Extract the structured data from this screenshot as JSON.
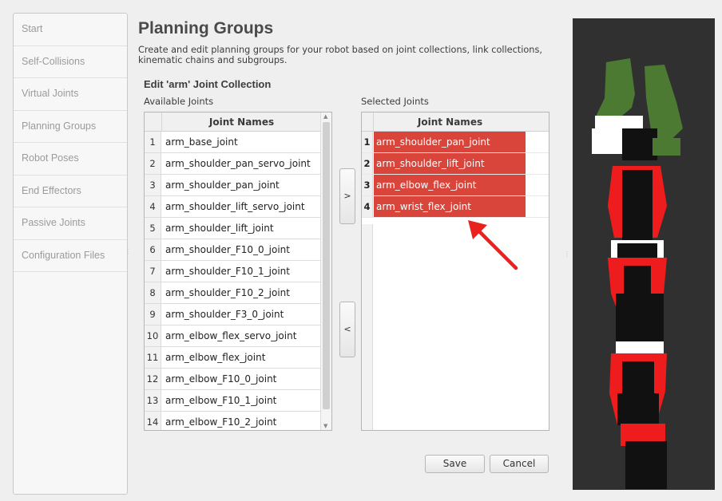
{
  "sidebar": {
    "items": [
      {
        "label": "Start"
      },
      {
        "label": "Self-Collisions"
      },
      {
        "label": "Virtual Joints"
      },
      {
        "label": "Planning Groups"
      },
      {
        "label": "Robot Poses"
      },
      {
        "label": "End Effectors"
      },
      {
        "label": "Passive Joints"
      },
      {
        "label": "Configuration Files"
      }
    ]
  },
  "main": {
    "title": "Planning Groups",
    "description": "Create and edit planning groups for your robot based on joint collections, link collections, kinematic chains and subgroups.",
    "subtitle": "Edit 'arm' Joint Collection",
    "available_label": "Available Joints",
    "selected_label": "Selected Joints",
    "column_header": "Joint Names",
    "available_joints": [
      {
        "num": "1",
        "name": "arm_base_joint"
      },
      {
        "num": "2",
        "name": "arm_shoulder_pan_servo_joint"
      },
      {
        "num": "3",
        "name": "arm_shoulder_pan_joint"
      },
      {
        "num": "4",
        "name": "arm_shoulder_lift_servo_joint"
      },
      {
        "num": "5",
        "name": "arm_shoulder_lift_joint"
      },
      {
        "num": "6",
        "name": "arm_shoulder_F10_0_joint"
      },
      {
        "num": "7",
        "name": "arm_shoulder_F10_1_joint"
      },
      {
        "num": "8",
        "name": "arm_shoulder_F10_2_joint"
      },
      {
        "num": "9",
        "name": "arm_shoulder_F3_0_joint"
      },
      {
        "num": "10",
        "name": "arm_elbow_flex_servo_joint"
      },
      {
        "num": "11",
        "name": "arm_elbow_flex_joint"
      },
      {
        "num": "12",
        "name": "arm_elbow_F10_0_joint"
      },
      {
        "num": "13",
        "name": "arm_elbow_F10_1_joint"
      },
      {
        "num": "14",
        "name": "arm_elbow_F10_2_joint"
      }
    ],
    "selected_joints": [
      {
        "num": "1",
        "name": "arm_shoulder_pan_joint"
      },
      {
        "num": "2",
        "name": "arm_shoulder_lift_joint"
      },
      {
        "num": "3",
        "name": "arm_elbow_flex_joint"
      },
      {
        "num": "4",
        "name": "arm_wrist_flex_joint"
      }
    ],
    "add_label": ">",
    "remove_label": "<",
    "save_label": "Save",
    "cancel_label": "Cancel"
  },
  "colors": {
    "selection": "#d9453a",
    "annotation_arrow": "#e8231f",
    "robot_red": "#ee1c1c",
    "robot_green": "#4d7a32",
    "viewport_bg": "#303030"
  }
}
